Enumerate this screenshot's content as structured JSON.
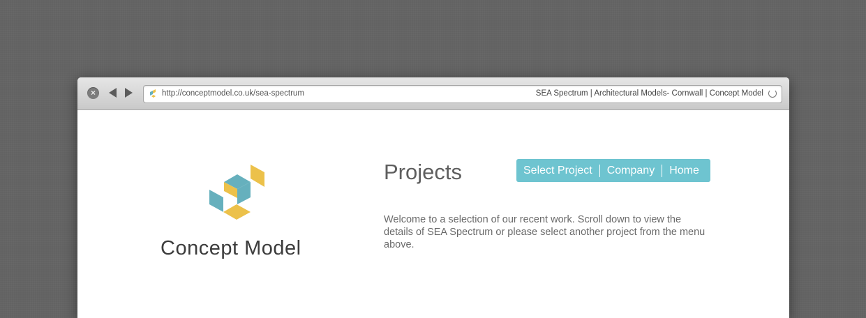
{
  "browser": {
    "url": "http://conceptmodel.co.uk/sea-spectrum",
    "page_title": "SEA Spectrum | Architectural Models- Cornwall | Concept Model"
  },
  "brand": {
    "name": "Concept Model"
  },
  "page": {
    "heading": "Projects",
    "intro": "Welcome to a selection of our recent work. Scroll down to view the details of SEA Spectrum or please select another project from the menu above."
  },
  "menu": {
    "items": [
      {
        "label": "Select Project"
      },
      {
        "label": "Company"
      },
      {
        "label": "Home"
      }
    ]
  },
  "colors": {
    "accent_teal": "#6ec4d0",
    "logo_blue": "#66b0bd",
    "logo_yellow": "#ecc14a",
    "background": "#626262"
  },
  "icons": {
    "close": "close-icon",
    "back": "back-arrow-icon",
    "forward": "forward-arrow-icon",
    "favicon": "favicon-icon",
    "reload": "reload-icon"
  }
}
